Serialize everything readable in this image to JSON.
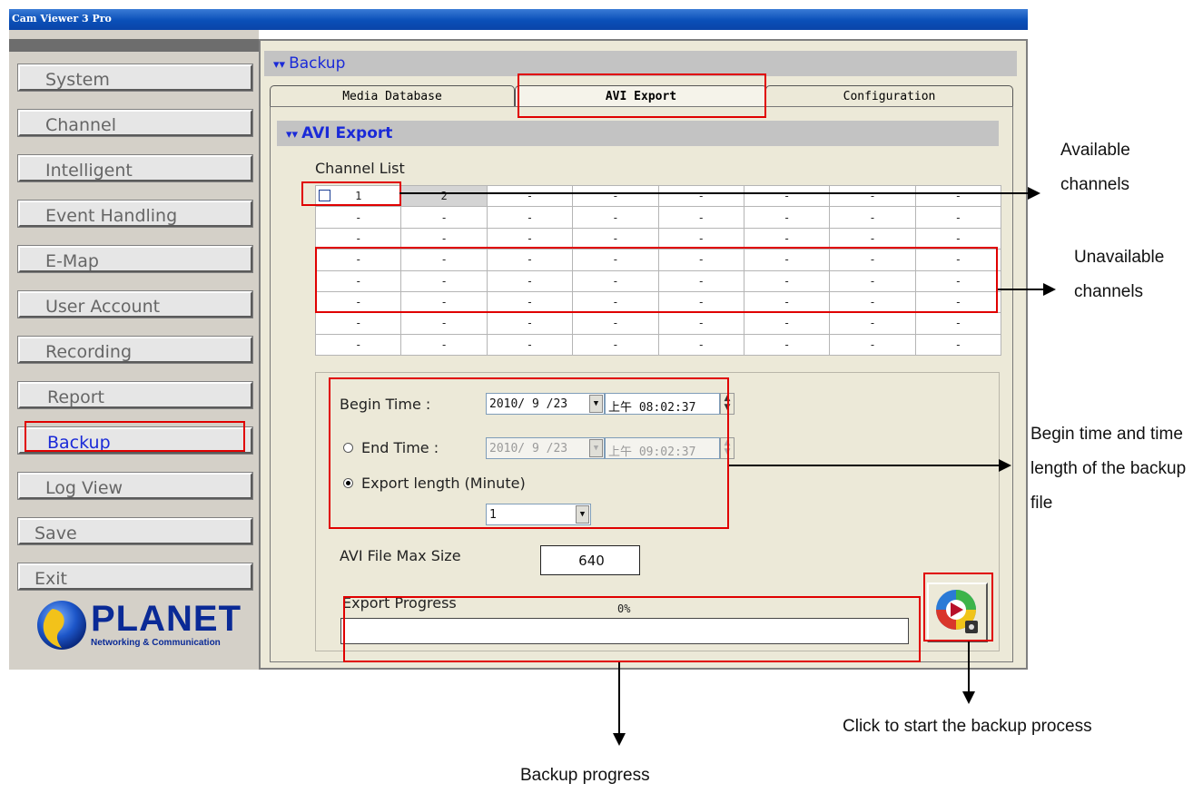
{
  "window": {
    "title": "Cam Viewer 3 Pro"
  },
  "sidebar": {
    "items": [
      {
        "label": "System"
      },
      {
        "label": "Channel"
      },
      {
        "label": "Intelligent"
      },
      {
        "label": "Event Handling"
      },
      {
        "label": "E-Map"
      },
      {
        "label": "User Account"
      },
      {
        "label": "Recording"
      },
      {
        "label": "Report"
      },
      {
        "label": "Backup",
        "active": true
      },
      {
        "label": "Log View"
      },
      {
        "label": "Save"
      },
      {
        "label": "Exit"
      }
    ],
    "logo": {
      "brand": "PLANET",
      "tagline": "Networking & Communication"
    }
  },
  "main": {
    "section_title": "Backup",
    "tabs": [
      {
        "label": "Media Database"
      },
      {
        "label": "AVI Export",
        "active": true
      },
      {
        "label": "Configuration"
      }
    ],
    "subsection_title": "AVI Export",
    "channel_list": {
      "label": "Channel List",
      "rows": [
        [
          "1",
          "2",
          "-",
          "-",
          "-",
          "-",
          "-",
          "-"
        ],
        [
          "-",
          "-",
          "-",
          "-",
          "-",
          "-",
          "-",
          "-"
        ],
        [
          "-",
          "-",
          "-",
          "-",
          "-",
          "-",
          "-",
          "-"
        ],
        [
          "-",
          "-",
          "-",
          "-",
          "-",
          "-",
          "-",
          "-"
        ],
        [
          "-",
          "-",
          "-",
          "-",
          "-",
          "-",
          "-",
          "-"
        ],
        [
          "-",
          "-",
          "-",
          "-",
          "-",
          "-",
          "-",
          "-"
        ],
        [
          "-",
          "-",
          "-",
          "-",
          "-",
          "-",
          "-",
          "-"
        ],
        [
          "-",
          "-",
          "-",
          "-",
          "-",
          "-",
          "-",
          "-"
        ]
      ]
    },
    "begin_time": {
      "label": "Begin Time :",
      "date": "2010/ 9 /23",
      "time": "上午 08:02:37"
    },
    "end_time": {
      "label": "End Time :",
      "date": "2010/ 9 /23",
      "time": "上午 09:02:37",
      "selected": false
    },
    "export_length": {
      "label": "Export length (Minute)",
      "value": "1",
      "selected": true
    },
    "avi_max_size": {
      "label": "AVI File Max Size",
      "value": "640"
    },
    "export_progress": {
      "label": "Export Progress",
      "percent_text": "0%",
      "fraction": 0
    }
  },
  "annotations": {
    "available": "Available channels",
    "unavailable": "Unavailable channels",
    "time": "Begin time and time length of the backup file",
    "progress": "Backup progress",
    "start": "Click to start the backup process"
  },
  "colors": {
    "title_bar": "#0a4fb8",
    "accent": "#1a2ad8",
    "highlight": "#e00000"
  }
}
